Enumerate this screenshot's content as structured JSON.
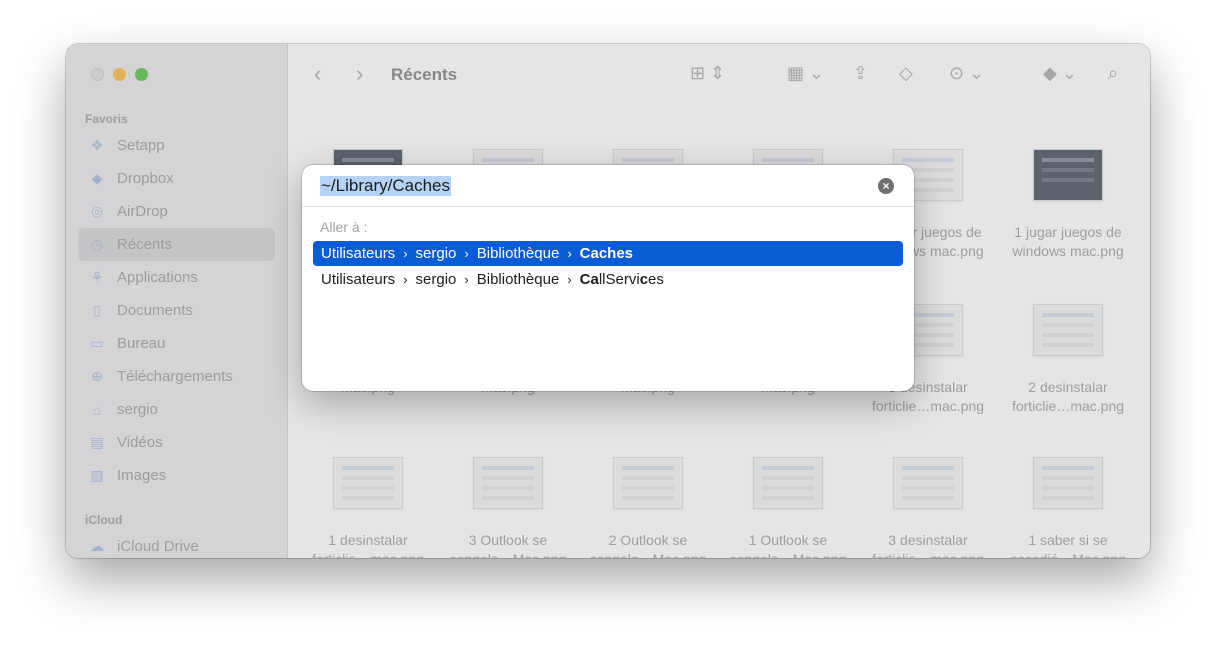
{
  "window": {
    "title": "Récents"
  },
  "sidebar": {
    "section_favorites": "Favoris",
    "favorites": [
      {
        "label": "Setapp",
        "icon": "setapp-icon"
      },
      {
        "label": "Dropbox",
        "icon": "dropbox-icon"
      },
      {
        "label": "AirDrop",
        "icon": "airdrop-icon"
      },
      {
        "label": "Récents",
        "icon": "clock-icon",
        "active": true
      },
      {
        "label": "Applications",
        "icon": "applications-icon"
      },
      {
        "label": "Documents",
        "icon": "document-icon"
      },
      {
        "label": "Bureau",
        "icon": "desktop-icon"
      },
      {
        "label": "Téléchargements",
        "icon": "download-icon"
      },
      {
        "label": "sergio",
        "icon": "home-icon"
      },
      {
        "label": "Vidéos",
        "icon": "film-icon"
      },
      {
        "label": "Images",
        "icon": "image-icon"
      }
    ],
    "section_icloud": "iCloud",
    "icloud": [
      {
        "label": "iCloud Drive",
        "icon": "cloud-icon"
      }
    ]
  },
  "files": {
    "row1": [
      {
        "line1": "",
        "line2": ""
      },
      {
        "line1": "",
        "line2": ""
      },
      {
        "line1": "",
        "line2": ""
      },
      {
        "line1": "",
        "line2": ""
      },
      {
        "line1": "2 jugar juegos de",
        "line2": "windows mac.png"
      },
      {
        "line1": "1 jugar juegos de",
        "line2": "windows mac.png"
      }
    ],
    "row2": [
      {
        "line1": "",
        "line2": "mac.png"
      },
      {
        "line1": "",
        "line2": "mac.png"
      },
      {
        "line1": "",
        "line2": "mac.png"
      },
      {
        "line1": "",
        "line2": "mac.png"
      },
      {
        "line1": "3 desinstalar",
        "line2": "forticlie…mac.png"
      },
      {
        "line1": "2 desinstalar",
        "line2": "forticlie…mac.png"
      }
    ],
    "row3": [
      {
        "line1": "1 desinstalar",
        "line2": "forticlie…mac.png"
      },
      {
        "line1": "3 Outlook se",
        "line2": "congela…Mac.png"
      },
      {
        "line1": "2 Outlook se",
        "line2": "congela…Mac.png"
      },
      {
        "line1": "1 Outlook se",
        "line2": "congela…Mac.png"
      },
      {
        "line1": "3 desinstalar",
        "line2": "forticlie…mac.png"
      },
      {
        "line1": "1 saber si se",
        "line2": "accedió…Mac.png"
      }
    ]
  },
  "goto": {
    "path": "~/Library/Caches",
    "label": "Aller à :",
    "suggestions": [
      {
        "c1": "Utilisateurs",
        "c2": "sergio",
        "c3": "Bibliothèque",
        "c4": "Caches"
      },
      {
        "c1": "Utilisateurs",
        "c2": "sergio",
        "c3": "Bibliothèque",
        "c4a": "Ca",
        "c4b": "llServi",
        "c4c": "c",
        "c4d": "es"
      }
    ]
  },
  "colors": {
    "selection": "#0a5bd6",
    "path_highlight": "#b4d3f6"
  }
}
